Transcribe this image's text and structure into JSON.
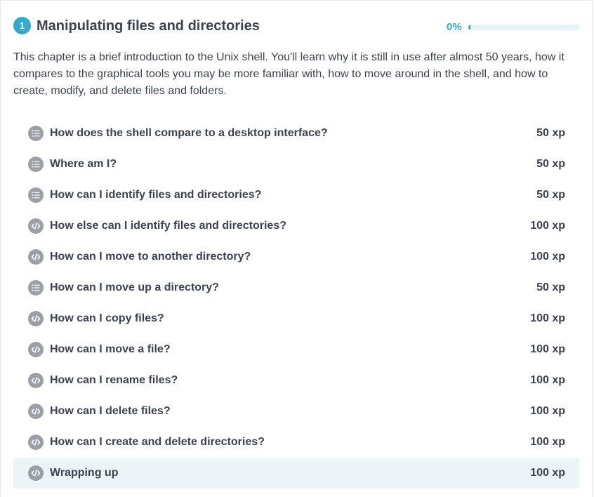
{
  "chapter": {
    "number": "1",
    "title": "Manipulating files and directories",
    "progress_label": "0%",
    "progress_fraction": 0,
    "description": "This chapter is a brief introduction to the Unix shell. You'll learn why it is still in use after almost 50 years, how it compares to the graphical tools you may be more familiar with, how to move around in the shell, and how to create, modify, and delete files and folders."
  },
  "exercises": [
    {
      "title": "How does the shell compare to a desktop interface?",
      "xp": "50 xp",
      "icon": "multiple-choice-icon",
      "active": false
    },
    {
      "title": "Where am I?",
      "xp": "50 xp",
      "icon": "multiple-choice-icon",
      "active": false
    },
    {
      "title": "How can I identify files and directories?",
      "xp": "50 xp",
      "icon": "multiple-choice-icon",
      "active": false
    },
    {
      "title": "How else can I identify files and directories?",
      "xp": "100 xp",
      "icon": "code-icon",
      "active": false
    },
    {
      "title": "How can I move to another directory?",
      "xp": "100 xp",
      "icon": "code-icon",
      "active": false
    },
    {
      "title": "How can I move up a directory?",
      "xp": "50 xp",
      "icon": "multiple-choice-icon",
      "active": false
    },
    {
      "title": "How can I copy files?",
      "xp": "100 xp",
      "icon": "code-icon",
      "active": false
    },
    {
      "title": "How can I move a file?",
      "xp": "100 xp",
      "icon": "code-icon",
      "active": false
    },
    {
      "title": "How can I rename files?",
      "xp": "100 xp",
      "icon": "code-icon",
      "active": false
    },
    {
      "title": "How can I delete files?",
      "xp": "100 xp",
      "icon": "code-icon",
      "active": false
    },
    {
      "title": "How can I create and delete directories?",
      "xp": "100 xp",
      "icon": "code-icon",
      "active": false
    },
    {
      "title": "Wrapping up",
      "xp": "100 xp",
      "icon": "code-icon",
      "active": true
    }
  ],
  "colors": {
    "accent": "#33aacc",
    "text": "#3d4251",
    "icon_gray": "#9aa0a6",
    "active_row_bg": "#ebf4f7"
  }
}
